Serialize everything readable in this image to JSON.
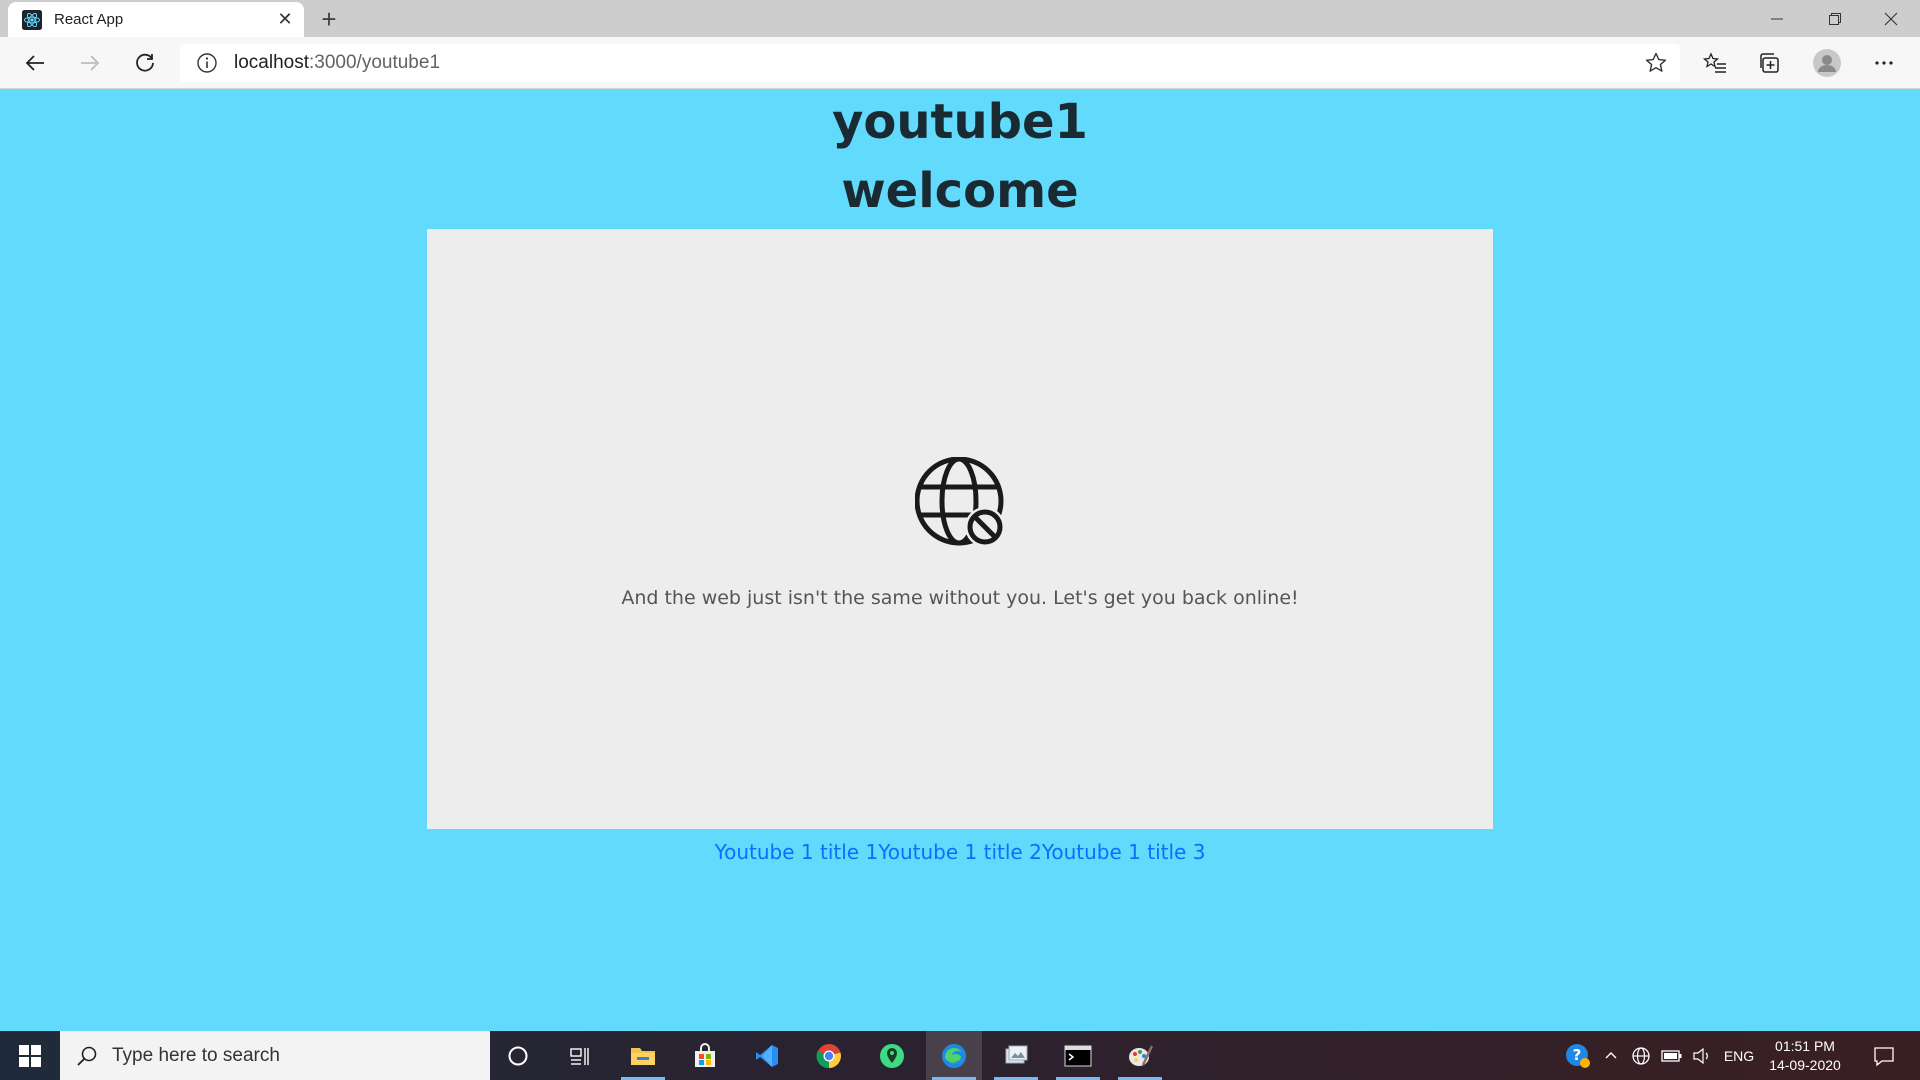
{
  "browser": {
    "tab_title": "React App",
    "url_host": "localhost",
    "url_path": ":3000/youtube1"
  },
  "page": {
    "heading": "youtube1",
    "subheading": "welcome",
    "offline_message": "And the web just isn't the same without you. Let's get you back online!",
    "links": [
      {
        "label": "Youtube 1 title 1"
      },
      {
        "label": "Youtube 1 title 2"
      },
      {
        "label": "Youtube 1 title 3"
      }
    ]
  },
  "taskbar": {
    "search_placeholder": "Type here to search",
    "language": "ENG",
    "time": "01:51 PM",
    "date": "14-09-2020",
    "apps": [
      "cortana-icon",
      "task-view-icon",
      "file-explorer-icon",
      "store-icon",
      "vscode-icon",
      "chrome-icon",
      "maps-icon",
      "edge-icon",
      "photos-icon",
      "terminal-icon",
      "paint-icon"
    ]
  },
  "colors": {
    "page_bg": "#61dafb",
    "link": "#0d6efd",
    "heading": "#1a2a33"
  }
}
